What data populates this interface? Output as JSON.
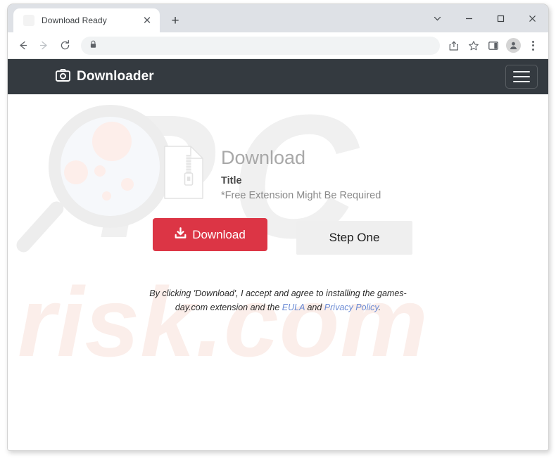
{
  "browser": {
    "tab": {
      "title": "Download Ready",
      "close_label": "✕"
    },
    "new_tab_label": "+",
    "window_controls": [
      {
        "name": "tab-search",
        "label": "⌵"
      },
      {
        "name": "minimize",
        "label": "–"
      },
      {
        "name": "maximize",
        "label": "□"
      },
      {
        "name": "close",
        "label": "✕"
      }
    ],
    "nav": {
      "back": "←",
      "forward": "→",
      "reload": "⟳"
    },
    "omnibox": {
      "url": "",
      "placeholder": "",
      "security_icon": "lock-icon"
    },
    "toolbar_icons": [
      "share-icon",
      "bookmark-star-icon",
      "side-panel-icon",
      "profile-avatar-icon",
      "three-dot-menu-icon"
    ]
  },
  "site": {
    "header": {
      "brand_icon": "camera-icon",
      "brand_name": "Downloader",
      "menu_icon": "hamburger-icon"
    },
    "download_card": {
      "file_icon": "zip-file-icon",
      "heading": "Download",
      "title": "Title",
      "note": "*Free Extension Might Be Required"
    },
    "buttons": {
      "download": {
        "label": "Download",
        "icon": "download-arrow-icon",
        "color": "#dc3545"
      },
      "step_one": {
        "label": "Step One",
        "color": "#efefef"
      }
    },
    "disclaimer": {
      "part1": "By clicking 'Download', I accept and agree to installing the games-day.com extension and the ",
      "link1": "EULA",
      "part2": " and ",
      "link2": "Privacy Policy",
      "part3": "."
    },
    "watermark": {
      "initials": "PC",
      "domain": "risk.com"
    },
    "colors": {
      "header_bg": "#343a40",
      "accent_red": "#dc3545",
      "link_blue": "#6b8bd4",
      "step_gray": "#efefef"
    }
  }
}
